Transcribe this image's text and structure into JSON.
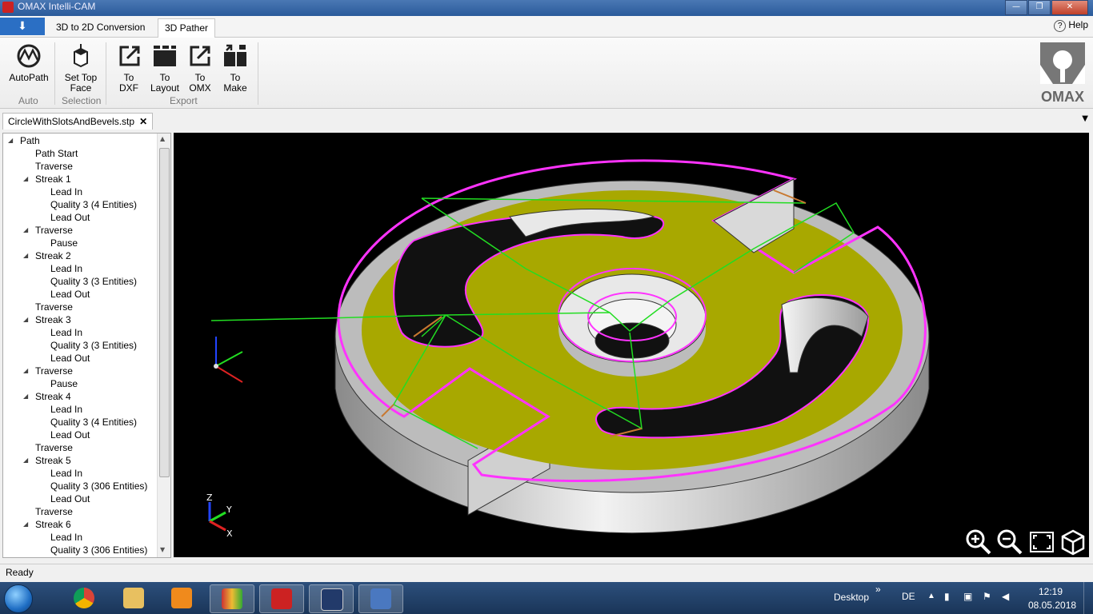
{
  "window": {
    "title": "OMAX Intelli-CAM",
    "minimize": "—",
    "maximize": "❐",
    "close": "✕"
  },
  "ribbon_tabs": {
    "app_menu": "⬇",
    "tab1": "3D to 2D Conversion",
    "tab2": "3D Pather",
    "help": "Help"
  },
  "ribbon": {
    "autopath": "AutoPath",
    "set_top_face_1": "Set Top",
    "set_top_face_2": "Face",
    "to_dxf_1": "To",
    "to_dxf_2": "DXF",
    "to_layout_1": "To",
    "to_layout_2": "Layout",
    "to_omx_1": "To",
    "to_omx_2": "OMX",
    "to_make_1": "To",
    "to_make_2": "Make",
    "group_auto": "Auto",
    "group_selection": "Selection",
    "group_export": "Export",
    "logo_text": "OMAX"
  },
  "document_tab": {
    "name": "CircleWithSlotsAndBevels.stp",
    "close": "✕"
  },
  "tree": [
    {
      "label": "Path",
      "expander": "◢"
    },
    {
      "label": "Path Start"
    },
    {
      "label": "Traverse"
    },
    {
      "label": "Streak 1",
      "expander": "◢"
    },
    {
      "label": "Lead In"
    },
    {
      "label": "Quality 3 (4 Entities)"
    },
    {
      "label": "Lead Out"
    },
    {
      "label": "Traverse",
      "expander": "◢"
    },
    {
      "label": "Pause"
    },
    {
      "label": "Streak 2",
      "expander": "◢"
    },
    {
      "label": "Lead In"
    },
    {
      "label": "Quality 3 (3 Entities)"
    },
    {
      "label": "Lead Out"
    },
    {
      "label": "Traverse"
    },
    {
      "label": "Streak 3",
      "expander": "◢"
    },
    {
      "label": "Lead In"
    },
    {
      "label": "Quality 3 (3 Entities)"
    },
    {
      "label": "Lead Out"
    },
    {
      "label": "Traverse",
      "expander": "◢"
    },
    {
      "label": "Pause"
    },
    {
      "label": "Streak 4",
      "expander": "◢"
    },
    {
      "label": "Lead In"
    },
    {
      "label": "Quality 3 (4 Entities)"
    },
    {
      "label": "Lead Out"
    },
    {
      "label": "Traverse"
    },
    {
      "label": "Streak 5",
      "expander": "◢"
    },
    {
      "label": "Lead In"
    },
    {
      "label": "Quality 3 (306 Entities)"
    },
    {
      "label": "Lead Out"
    },
    {
      "label": "Traverse"
    },
    {
      "label": "Streak 6",
      "expander": "◢"
    },
    {
      "label": "Lead In"
    },
    {
      "label": "Quality 3 (306 Entities)"
    }
  ],
  "viewport": {
    "axis_z": "Z",
    "axis_y": "Y",
    "axis_x": "X"
  },
  "status": {
    "text": "Ready"
  },
  "taskbar": {
    "desktop": "Desktop",
    "chevron": "»",
    "lang": "DE",
    "time": "12:19",
    "date": "08.05.2018"
  },
  "colors": {
    "face": "#a8a800",
    "path_magenta": "#ff33ff",
    "traverse_green": "#22dd22",
    "leadin_orange": "#c87830",
    "viewport_bg": "#000000"
  }
}
